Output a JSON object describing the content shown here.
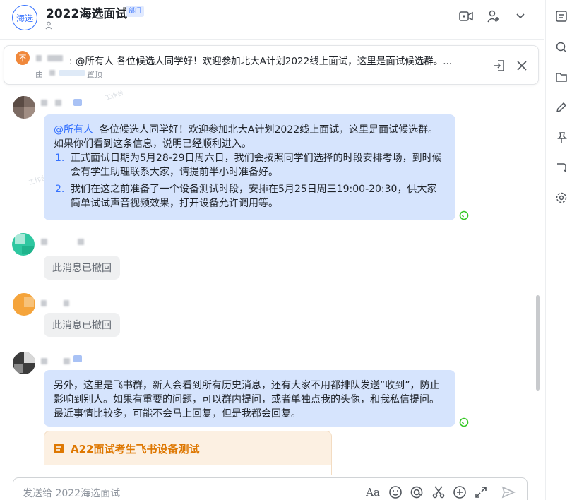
{
  "header": {
    "avatar_text": "海选",
    "title": "2022海选面试",
    "tag": "部门",
    "icons": [
      "video-call-icon",
      "add-member-icon",
      "chevron-down-icon"
    ]
  },
  "pin": {
    "avatar_text": "不",
    "message": ": @所有人 各位候选人同学好！欢迎参加北大A计划2022线上面试，这里是面试候选群。...",
    "by": "由",
    "label": "置顶"
  },
  "messages": [
    {
      "type": "text",
      "mention": "@所有人",
      "intro": "各位候选人同学好！欢迎参加北大A计划2022线上面试，这里是面试候选群。如果你们看到这条信息，说明已经顺利进入。",
      "items": [
        {
          "num": "1.",
          "text": "正式面试日期为5月28-29日周六日，我们会按照同学们选择的时段安排考场，到时候会有学生助理联系大家，请提前半小时准备好。"
        },
        {
          "num": "2.",
          "text": "我们在这之前准备了一个设备测试时段，安排在5月25日周三19:00-20:30，供大家简单试试声音视频效果，打开设备允许调用等。"
        }
      ]
    },
    {
      "type": "recalled",
      "text": "此消息已撤回"
    },
    {
      "type": "recalled",
      "text": "此消息已撤回"
    },
    {
      "type": "text",
      "text": "另外，这里是飞书群，新人会看到所有历史消息，还有大家不用都排队发送“收到”，防止影响到别人。如果有重要的问题，可以群内提问，或者单独点我的头像，和我私信提问。最近事情比较多，可能不会马上回复，但是我都会回复。"
    },
    {
      "type": "card",
      "title": "A22面试考生飞书设备测试"
    }
  ],
  "input": {
    "placeholder": "发送给 2022海选面试",
    "tools": [
      "Aa",
      "emoji-icon",
      "mention-icon",
      "scissors-icon",
      "plus-icon",
      "expand-icon",
      "send-icon"
    ]
  },
  "sidebar": {
    "icons": [
      "announcement-icon",
      "search-icon",
      "folder-icon",
      "edit-icon",
      "pin-icon",
      "thread-icon",
      "settings-icon"
    ]
  },
  "colors": {
    "accent": "#3370ff",
    "bubble": "#d6e4fd",
    "card_title": "#de7802",
    "read_receipt": "#34c724"
  }
}
